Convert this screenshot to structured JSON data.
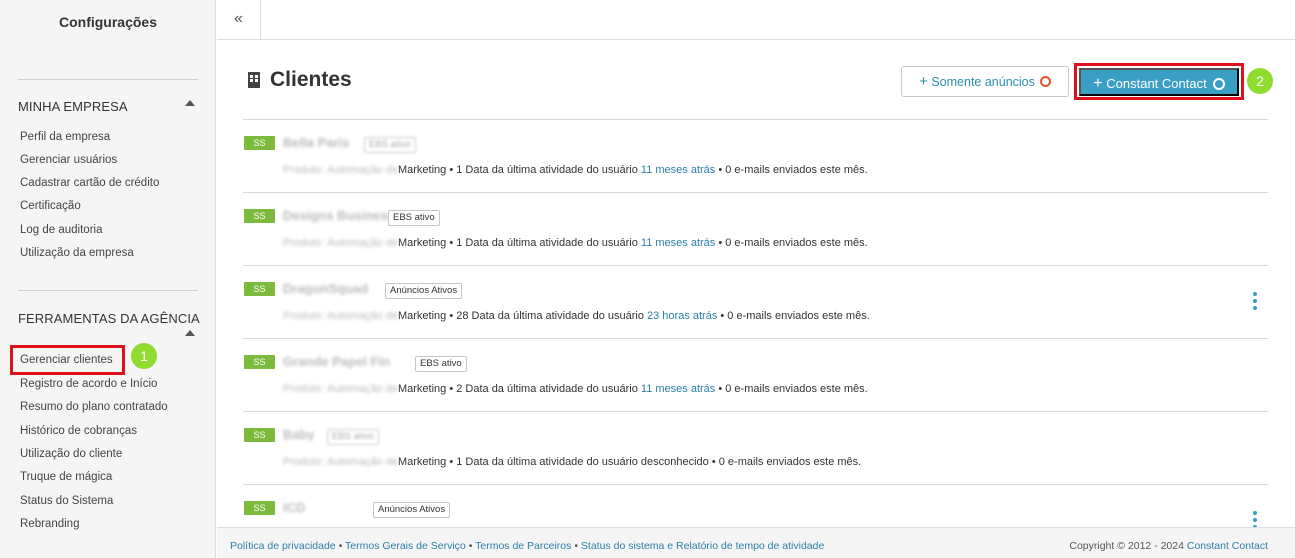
{
  "sidebar": {
    "title": "Configurações",
    "sections": [
      {
        "heading": "MINHA EMPRESA",
        "items": [
          "Perfil da empresa",
          "Gerenciar usuários",
          "Cadastrar cartão de crédito",
          "Certificação",
          "Log de auditoria",
          "Utilização da empresa"
        ]
      },
      {
        "heading": "FERRAMENTAS DA AGÊNCIA",
        "items": [
          "Gerenciar clientes",
          "Registro de acordo e Início",
          "Resumo do plano contratado",
          "Histórico de cobranças",
          "Utilização do cliente",
          "Truque de mágica",
          "Status do Sistema",
          "Rebranding"
        ]
      }
    ],
    "step_badge": "1"
  },
  "topbar": {
    "collapse_icon": "«"
  },
  "main": {
    "title": "Clientes",
    "buttons": {
      "ads_only": "Somente anúncios",
      "add_plus": "+",
      "constant_contact": "Constant Contact",
      "step_badge": "2"
    },
    "clients": [
      {
        "tag": "SS",
        "name": "Bella Paris",
        "pill": "EBS ativo",
        "pill_blurred": true,
        "product": "Produto: Automação de",
        "detail_mid": "Marketing • 1 Data da última atividade do usuário ",
        "last_activity": "11 meses atrás",
        "last_activity_link": true,
        "detail_end": " • 0 e-mails enviados este mês.",
        "kebab": false
      },
      {
        "tag": "SS",
        "name": "Designs Business",
        "pill": "EBS ativo",
        "pill_blurred": false,
        "product": "Produto: Automação de",
        "detail_mid": "Marketing • 1 Data da última atividade do usuário ",
        "last_activity": "11 meses atrás",
        "last_activity_link": true,
        "detail_end": " • 0 e-mails enviados este mês.",
        "kebab": false
      },
      {
        "tag": "SS",
        "name": "DragonSquad",
        "pill": "Anúncios Ativos",
        "pill_blurred": false,
        "product": "Produto: Automação de",
        "detail_mid": "Marketing • 28 Data da última atividade do usuário ",
        "last_activity": "23 horas atrás",
        "last_activity_link": true,
        "detail_end": " • 0 e-mails enviados este mês.",
        "kebab": true
      },
      {
        "tag": "SS",
        "name": "Grande Papel Fin",
        "pill": "EBS ativo",
        "pill_blurred": false,
        "product": "Produto: Automação de",
        "detail_mid": "Marketing • 2 Data da última atividade do usuário ",
        "last_activity": "11 meses atrás",
        "last_activity_link": true,
        "detail_end": " • 0 e-mails enviados este mês.",
        "kebab": false
      },
      {
        "tag": "SS",
        "name": "Baby",
        "pill": "EBS ativo",
        "pill_blurred": true,
        "product": "Produto: Automação de",
        "detail_mid": "Marketing • 1 Data da última atividade do usuário ",
        "last_activity": "desconhecido",
        "last_activity_link": false,
        "detail_end": " • 0 e-mails enviados este mês.",
        "kebab": false
      },
      {
        "tag": "SS",
        "name": "ICD",
        "pill": "Anúncios Ativos",
        "pill_blurred": false,
        "product": "",
        "detail_mid": "",
        "last_activity": "",
        "last_activity_link": false,
        "detail_end": "",
        "kebab": true
      }
    ]
  },
  "footer": {
    "links": [
      "Política de privacidade",
      "Termos Gerais de Serviço",
      "Termos de Parceiros",
      "Status do sistema e Relatório de tempo de atividade"
    ],
    "separator": " • ",
    "copyright": "Copyright © 2012 - 2024 ",
    "brand": "Constant Contact"
  },
  "colors": {
    "accent": "#3b9ec4",
    "highlight": "#e0101a",
    "badge": "#8fdc2e",
    "tag": "#7cba3c"
  }
}
